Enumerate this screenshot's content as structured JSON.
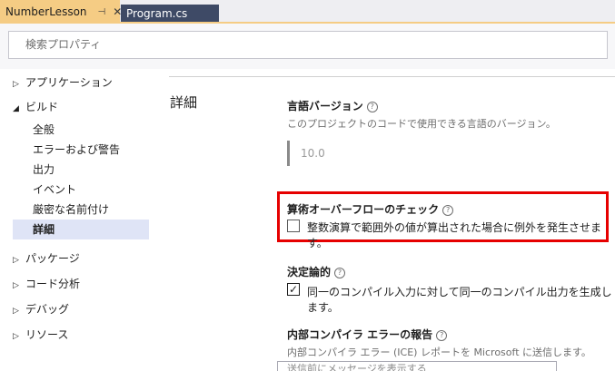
{
  "tabs": {
    "active": {
      "title": "NumberLesson",
      "pin_icon": "pin-icon",
      "close_icon": "close-icon"
    },
    "inactive": {
      "title": "Program.cs"
    }
  },
  "search": {
    "placeholder": "検索プロパティ"
  },
  "sidebar": {
    "categories": [
      {
        "label": "アプリケーション",
        "expanded": false
      },
      {
        "label": "ビルド",
        "expanded": true
      },
      {
        "label": "パッケージ",
        "expanded": false
      },
      {
        "label": "コード分析",
        "expanded": false
      },
      {
        "label": "デバッグ",
        "expanded": false
      },
      {
        "label": "リソース",
        "expanded": false
      }
    ],
    "build_items": [
      "全般",
      "エラーおよび警告",
      "出力",
      "イベント",
      "厳密な名前付け",
      "詳細"
    ],
    "selected": "詳細"
  },
  "section": {
    "title": "詳細"
  },
  "properties": {
    "lang_version": {
      "title": "言語バージョン",
      "desc": "このプロジェクトのコードで使用できる言語のバージョン。",
      "value": "10.0"
    },
    "overflow": {
      "title": "算術オーバーフローのチェック",
      "checkbox_label": "整数演算で範囲外の値が算出された場合に例外を発生させます。",
      "checked": false
    },
    "deterministic": {
      "title": "決定論的",
      "checkbox_label": "同一のコンパイル入力に対して同一のコンパイル出力を生成します。",
      "checked": true
    },
    "compiler_error": {
      "title": "内部コンパイラ エラーの報告",
      "desc": "内部コンパイラ エラー (ICE) レポートを Microsoft に送信します。",
      "value": "送信前にメッセージを表示する"
    }
  },
  "colors": {
    "highlight": "#e60000",
    "active_tab": "#f5cc84",
    "inactive_tab": "#3e4a66",
    "selected_item": "#dfe4f6"
  }
}
